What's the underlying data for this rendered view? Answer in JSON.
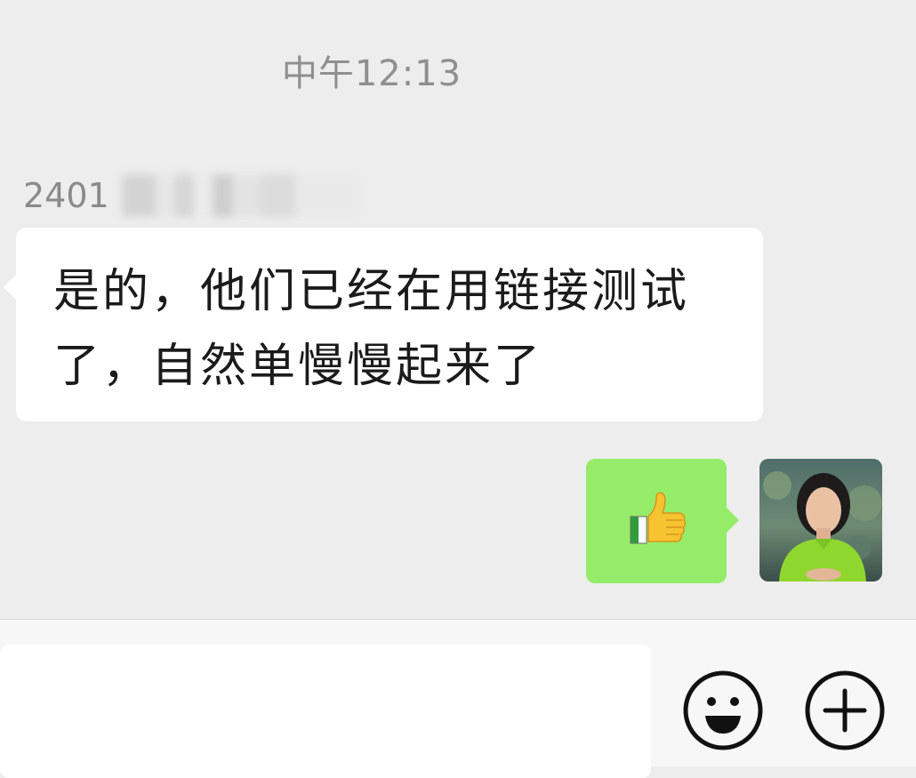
{
  "chat": {
    "timestamp": "中午12:13",
    "sender_prefix": "2401",
    "incoming_message": "是的，他们已经在用链接测试了，自然单慢慢起来了",
    "outgoing_message_icon": "thumbs-up-emoji"
  },
  "input": {
    "value": "",
    "placeholder": ""
  },
  "icons": {
    "emoji": "smiley-face-icon",
    "more": "plus-circle-icon"
  },
  "colors": {
    "background": "#ededed",
    "incoming_bubble": "#ffffff",
    "outgoing_bubble": "#95ec69",
    "timestamp_text": "#8f8f8f",
    "message_text": "#1b1b1b"
  }
}
